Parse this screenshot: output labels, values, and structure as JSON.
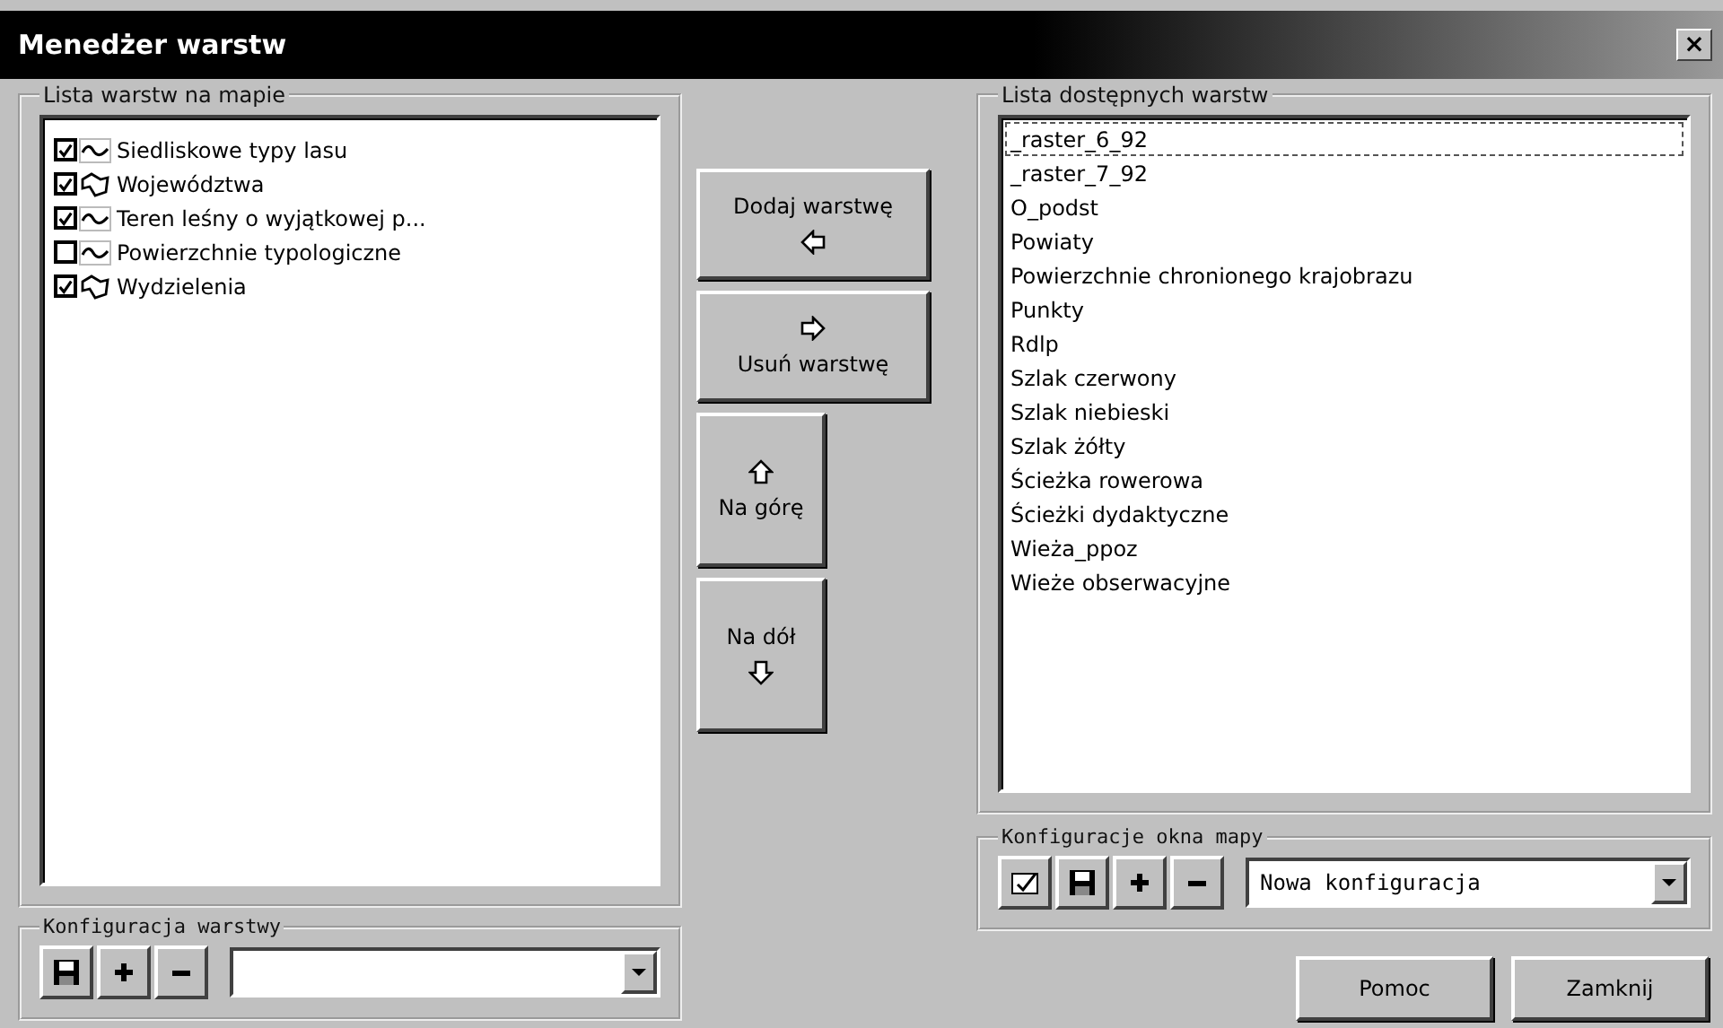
{
  "window": {
    "title": "Menedżer warstw",
    "close": "×"
  },
  "map_layers": {
    "title": "Lista warstw na mapie",
    "items": [
      {
        "label": "Siedliskowe typy lasu",
        "checked": true,
        "kind": "line"
      },
      {
        "label": "Województwa",
        "checked": true,
        "kind": "polygon"
      },
      {
        "label": "Teren leśny o wyjątkowej p...",
        "checked": true,
        "kind": "line"
      },
      {
        "label": "Powierzchnie typologiczne",
        "checked": false,
        "kind": "line"
      },
      {
        "label": "Wydzielenia",
        "checked": true,
        "kind": "polygon"
      }
    ]
  },
  "actions": [
    {
      "label": "Dodaj warstwę",
      "kind": "left"
    },
    {
      "label": "Usuń warstwę",
      "kind": "right"
    },
    {
      "label": "Na górę",
      "kind": "up"
    },
    {
      "label": "Na dół",
      "kind": "down"
    }
  ],
  "available_layers": {
    "title": "Lista dostępnych warstw",
    "items": [
      {
        "label": "_raster_6_92",
        "selected": true
      },
      {
        "label": "_raster_7_92",
        "selected": false
      },
      {
        "label": "O_podst",
        "selected": false
      },
      {
        "label": "Powiaty",
        "selected": false
      },
      {
        "label": "Powierzchnie chronionego krajobrazu",
        "selected": false
      },
      {
        "label": "Punkty",
        "selected": false
      },
      {
        "label": "Rdlp",
        "selected": false
      },
      {
        "label": "Szlak czerwony",
        "selected": false
      },
      {
        "label": "Szlak niebieski",
        "selected": false
      },
      {
        "label": "Szlak żółty",
        "selected": false
      },
      {
        "label": "Ścieżka rowerowa",
        "selected": false
      },
      {
        "label": "Ścieżki dydaktyczne",
        "selected": false
      },
      {
        "label": "Wieża_ppoz",
        "selected": false
      },
      {
        "label": "Wieże obserwacyjne",
        "selected": false
      }
    ]
  },
  "layer_config": {
    "title": "Konfiguracja warstwy",
    "tools": [
      {
        "kind": "save"
      },
      {
        "kind": "add"
      },
      {
        "kind": "remove"
      }
    ]
  },
  "map_config": {
    "title": "Konfiguracje okna mapy",
    "tools": [
      {
        "kind": "edit"
      },
      {
        "kind": "save"
      },
      {
        "kind": "add"
      },
      {
        "kind": "remove"
      }
    ],
    "value": "Nowa konfiguracja"
  },
  "buttons": [
    "Pomoc",
    "Zamknij"
  ]
}
